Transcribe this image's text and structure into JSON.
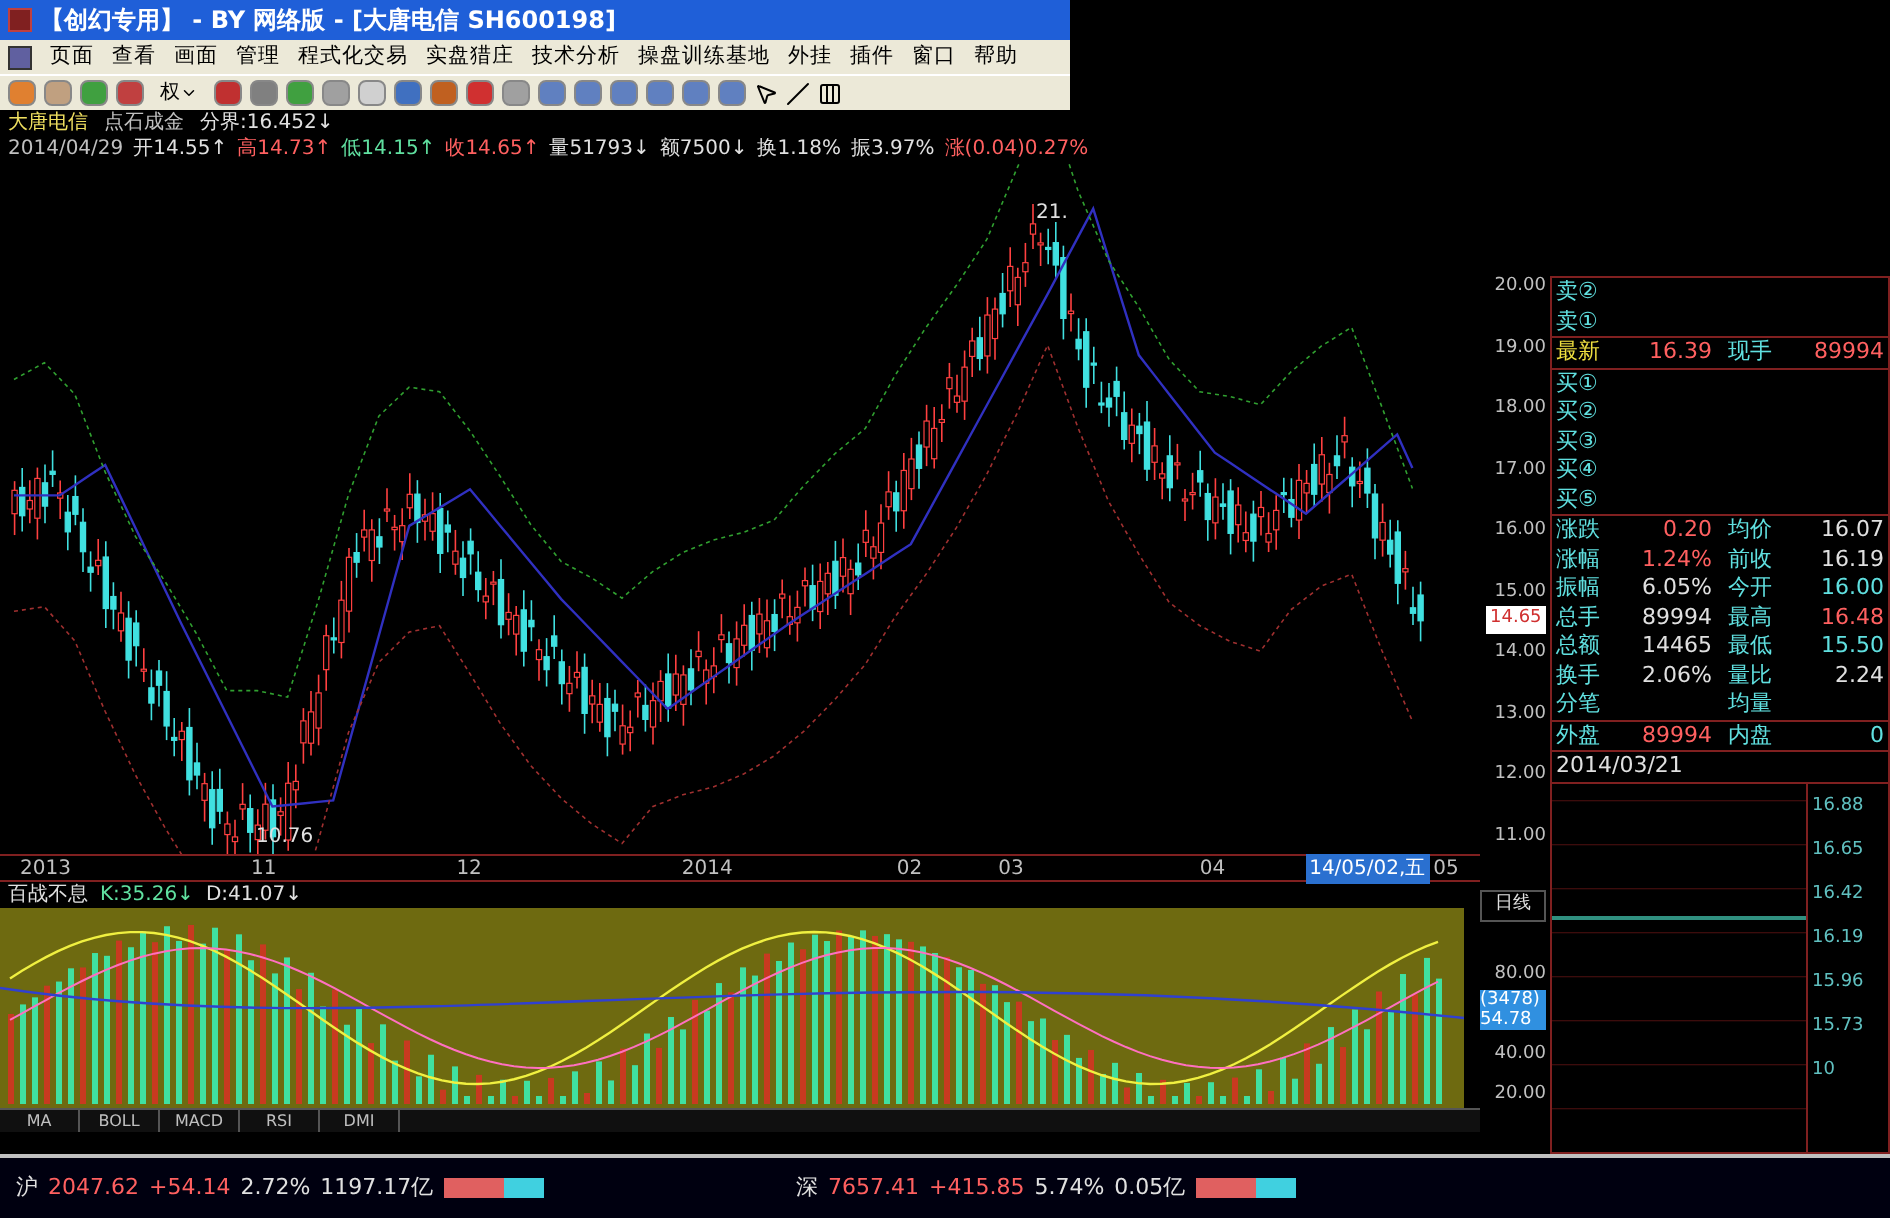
{
  "window": {
    "title": "【创幻专用】 - BY 网络版 - [大唐电信 SH600198]"
  },
  "menu": [
    "页面",
    "查看",
    "画面",
    "管理",
    "程式化交易",
    "实盘猎庄",
    "技术分析",
    "操盘训练基地",
    "外挂",
    "插件",
    "窗口",
    "帮助"
  ],
  "toolbar": {
    "dropdown": "权"
  },
  "stock_header": {
    "name": "大唐电信",
    "indicator": "点石成金",
    "boundary": "分界:16.452↓"
  },
  "quote_line": [
    {
      "text": "2014/04/29",
      "color": "#c0c0c0"
    },
    {
      "text": "开14.55↑",
      "color": "#e0e0e0"
    },
    {
      "text": "高14.73↑",
      "color": "#ff6060"
    },
    {
      "text": "低14.15↑",
      "color": "#60e0a0"
    },
    {
      "text": "收14.65↑",
      "color": "#ff6060"
    },
    {
      "text": "量51793↓",
      "color": "#e0e0e0"
    },
    {
      "text": "额7500↓",
      "color": "#e0e0e0"
    },
    {
      "text": "换1.18%",
      "color": "#e0e0e0"
    },
    {
      "text": "振3.97%",
      "color": "#e0e0e0"
    },
    {
      "text": "涨(0.04)0.27%",
      "color": "#ff6060"
    }
  ],
  "chart": {
    "peak_label": "21.",
    "low_label": "10.76",
    "current_price": "14.65",
    "price_axis": [
      "20.00",
      "19.00",
      "18.00",
      "17.00",
      "16.00",
      "15.00",
      "14.00",
      "13.00",
      "12.00",
      "11.00"
    ],
    "date_axis": [
      {
        "text": "2013",
        "selected": false
      },
      {
        "text": "11",
        "selected": false
      },
      {
        "text": "12",
        "selected": false
      },
      {
        "text": "2014",
        "selected": false
      },
      {
        "text": "02",
        "selected": false
      },
      {
        "text": "03",
        "selected": false
      },
      {
        "text": "04",
        "selected": false
      },
      {
        "text": "14/05/02,五",
        "selected": true
      },
      {
        "text": "05",
        "selected": false
      }
    ],
    "period": "日线"
  },
  "indicator": {
    "name": "百战不息",
    "values": [
      {
        "text": "K:35.26↓",
        "color": "#60e0a0"
      },
      {
        "text": "D:41.07↓",
        "color": "#e0e0e0"
      }
    ],
    "axis": [
      "80.00",
      "40.00",
      "20.00"
    ],
    "badge_top": "(3478)",
    "badge_value": "54.78"
  },
  "tabs": [
    {
      "label": "MA",
      "selected": false
    },
    {
      "label": "BOLL",
      "selected": false
    },
    {
      "label": "MACD",
      "selected": false
    },
    {
      "label": "RSI",
      "selected": false
    },
    {
      "label": "DMI",
      "selected": false
    }
  ],
  "quote_panel": {
    "sell": [
      "卖②",
      "卖①"
    ],
    "latest": {
      "label": "最新",
      "value": "16.39",
      "label2": "现手",
      "value2": "89994"
    },
    "buy": [
      "买①",
      "买②",
      "买③",
      "买④",
      "买⑤"
    ],
    "stats": [
      {
        "cells": [
          {
            "label": "涨跌",
            "value": "0.20",
            "color": "#ff6060"
          },
          {
            "label": "均价",
            "value": "16.07",
            "color": "#e0e0e0"
          }
        ]
      },
      {
        "cells": [
          {
            "label": "涨幅",
            "value": "1.24%",
            "color": "#ff6060"
          },
          {
            "label": "前收",
            "value": "16.19",
            "color": "#e0e0e0"
          }
        ]
      },
      {
        "cells": [
          {
            "label": "振幅",
            "value": "6.05%",
            "color": "#e0e0e0"
          },
          {
            "label": "今开",
            "value": "16.00",
            "color": "#60e0e0"
          }
        ]
      },
      {
        "cells": [
          {
            "label": "总手",
            "value": "89994",
            "color": "#e0e0e0"
          },
          {
            "label": "最高",
            "value": "16.48",
            "color": "#ff6060"
          }
        ]
      },
      {
        "cells": [
          {
            "label": "总额",
            "value": "14465",
            "color": "#e0e0e0"
          },
          {
            "label": "最低",
            "value": "15.50",
            "color": "#60e0e0"
          }
        ]
      },
      {
        "cells": [
          {
            "label": "换手",
            "value": "2.06%",
            "color": "#e0e0e0"
          },
          {
            "label": "量比",
            "value": "2.24",
            "color": "#e0e0e0"
          }
        ]
      },
      {
        "cells": [
          {
            "label": "分笔"
          },
          {
            "label": "均量"
          }
        ]
      }
    ],
    "outer": {
      "label": "外盘",
      "value": "89994",
      "label2": "内盘",
      "value2": "0"
    },
    "date": "2014/03/21",
    "mini_axis": [
      "16.88",
      "16.65",
      "16.42",
      "16.19",
      "15.96",
      "15.73",
      "10"
    ]
  },
  "status_bar": [
    {
      "market": "沪",
      "index": "2047.62",
      "change": "+54.14",
      "percent": "2.72%",
      "amount": "1197.17亿"
    },
    {
      "market": "深",
      "index": "7657.41",
      "change": "+415.85",
      "percent": "5.74%",
      "amount": "0.05亿"
    }
  ]
}
